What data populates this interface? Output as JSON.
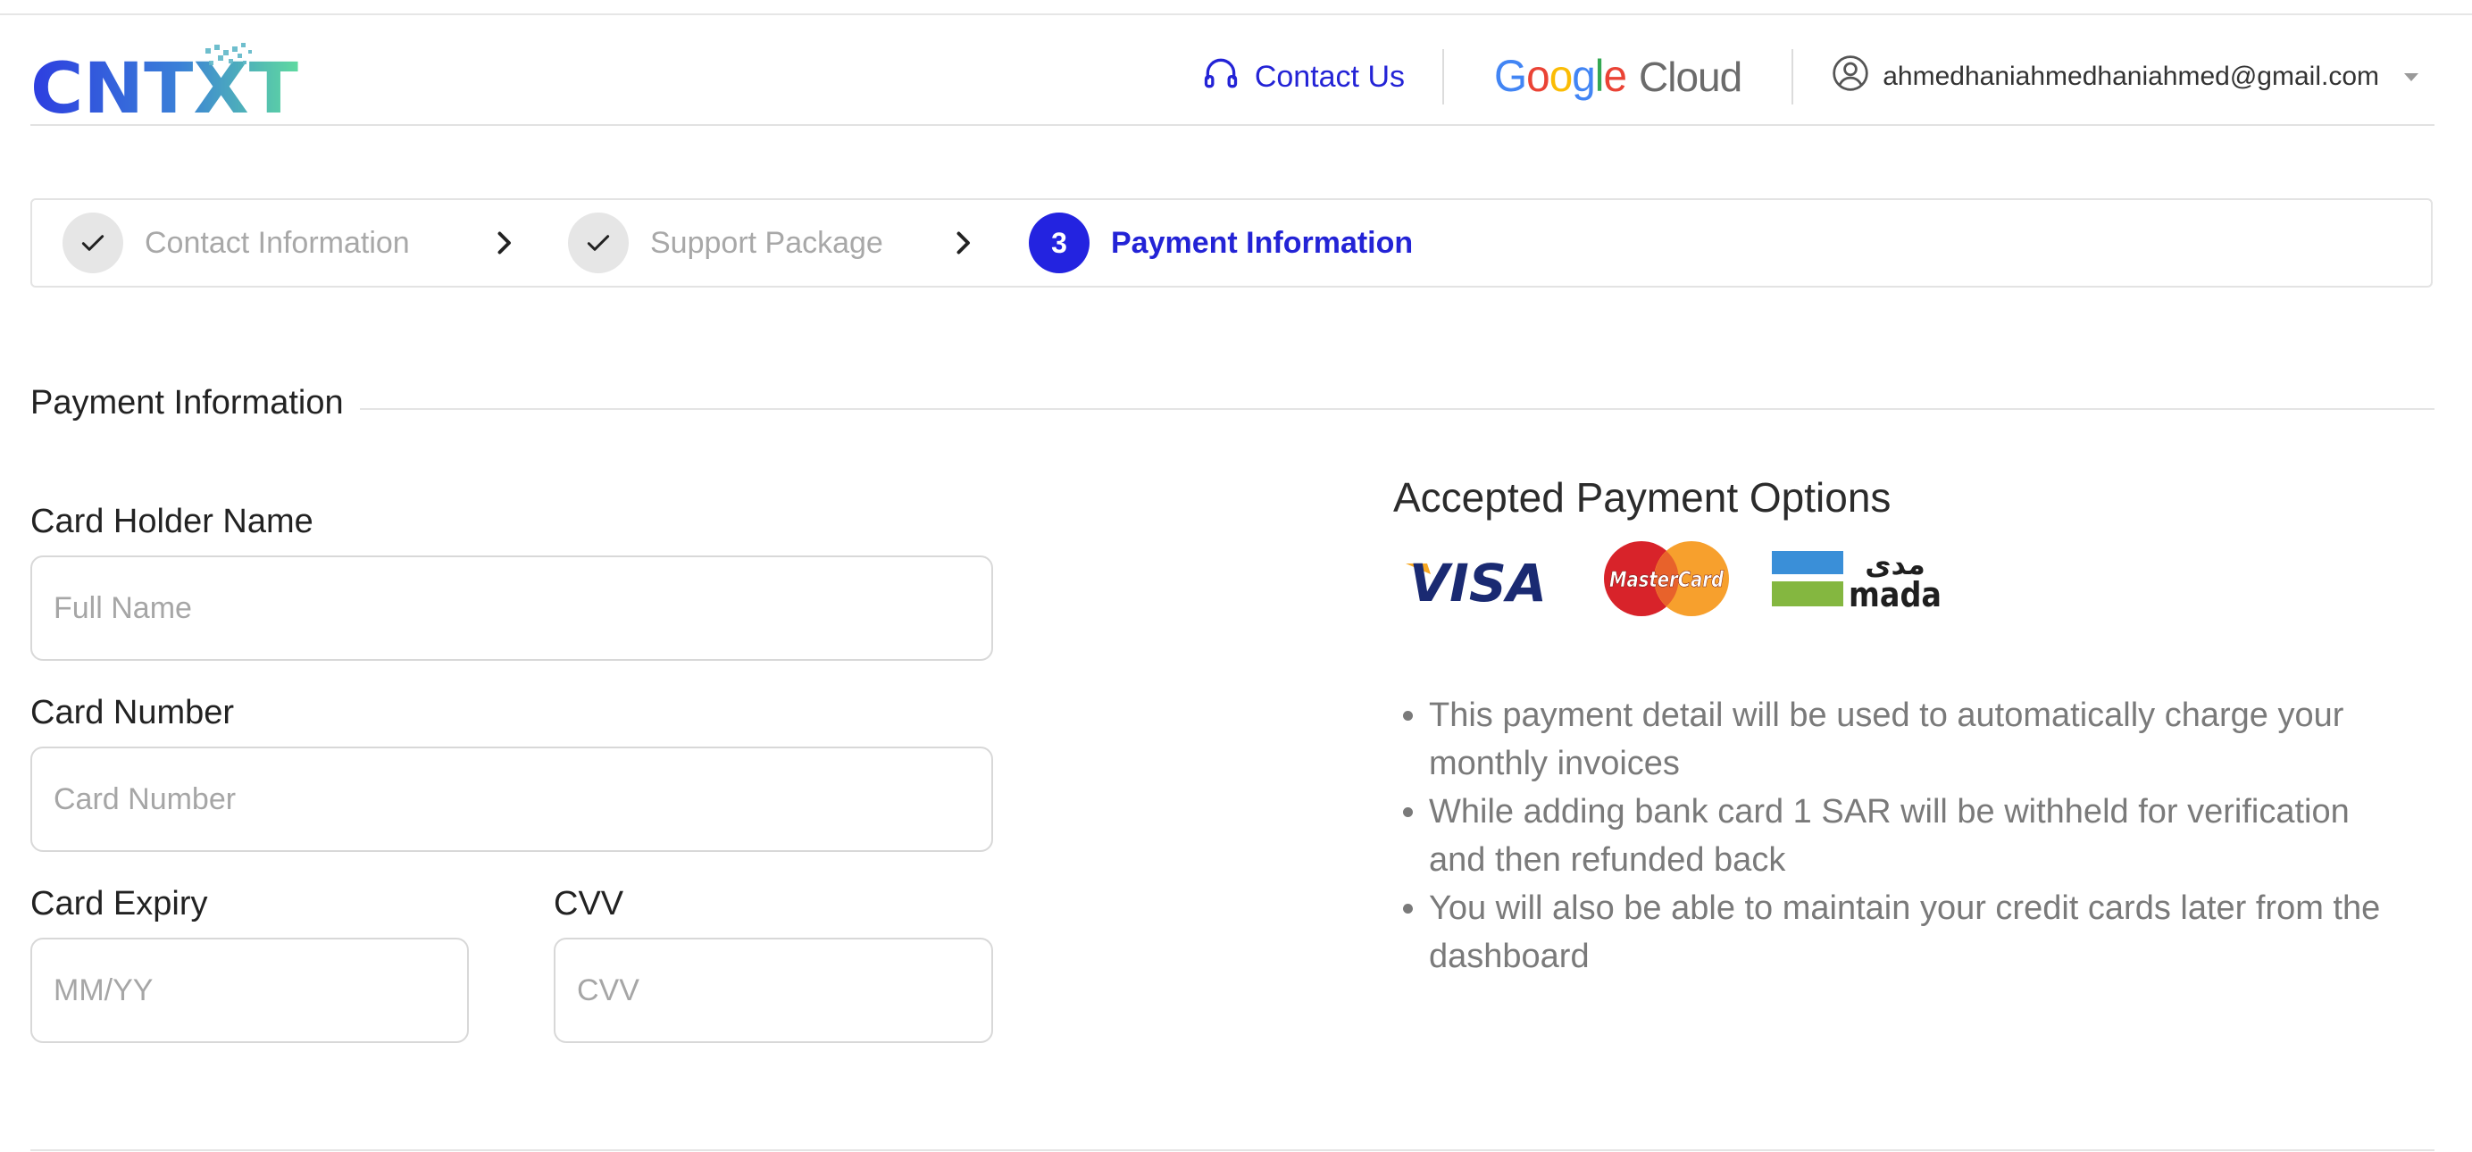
{
  "header": {
    "logo_text": "CNTXT",
    "contact_label": "Contact Us",
    "partner_brand": {
      "google": "Google",
      "cloud": "Cloud"
    },
    "account_email": "ahmedhaniahmedhaniahmed@gmail.com",
    "icons": {
      "contact": "headset-icon",
      "account": "user-circle-icon",
      "dropdown": "caret-down-icon"
    }
  },
  "stepper": {
    "steps": [
      {
        "label": "Contact Information",
        "state": "completed",
        "icon": "check-icon"
      },
      {
        "label": "Support Package",
        "state": "completed",
        "icon": "check-icon"
      },
      {
        "label": "Payment Information",
        "state": "active",
        "number": "3"
      }
    ],
    "separator_icon": "chevron-right-icon"
  },
  "section": {
    "title": "Payment Information"
  },
  "form": {
    "card_holder": {
      "label": "Card Holder Name",
      "placeholder": "Full Name",
      "value": ""
    },
    "card_number": {
      "label": "Card Number",
      "placeholder": "Card Number",
      "value": ""
    },
    "card_expiry": {
      "label": "Card Expiry",
      "placeholder": "MM/YY",
      "value": ""
    },
    "cvv": {
      "label": "CVV",
      "placeholder": "CVV",
      "value": ""
    }
  },
  "payment_options": {
    "title": "Accepted Payment Options",
    "logos": [
      {
        "name": "visa",
        "text": "VISA"
      },
      {
        "name": "mastercard",
        "text": "MasterCard"
      },
      {
        "name": "mada",
        "text": "mada",
        "arabic": "مدى"
      }
    ],
    "notes": [
      "This payment detail will be used to automatically charge your monthly invoices",
      "While adding bank card 1 SAR will be withheld for verification and then refunded back",
      "You will also be able to maintain your credit cards later from the dashboard"
    ]
  },
  "colors": {
    "accent": "#2323E0",
    "step_completed_bg": "#E6E6E6",
    "muted_text": "#A8A8A8",
    "note_text": "#7A7A7A",
    "border": "#D8D8D8"
  }
}
